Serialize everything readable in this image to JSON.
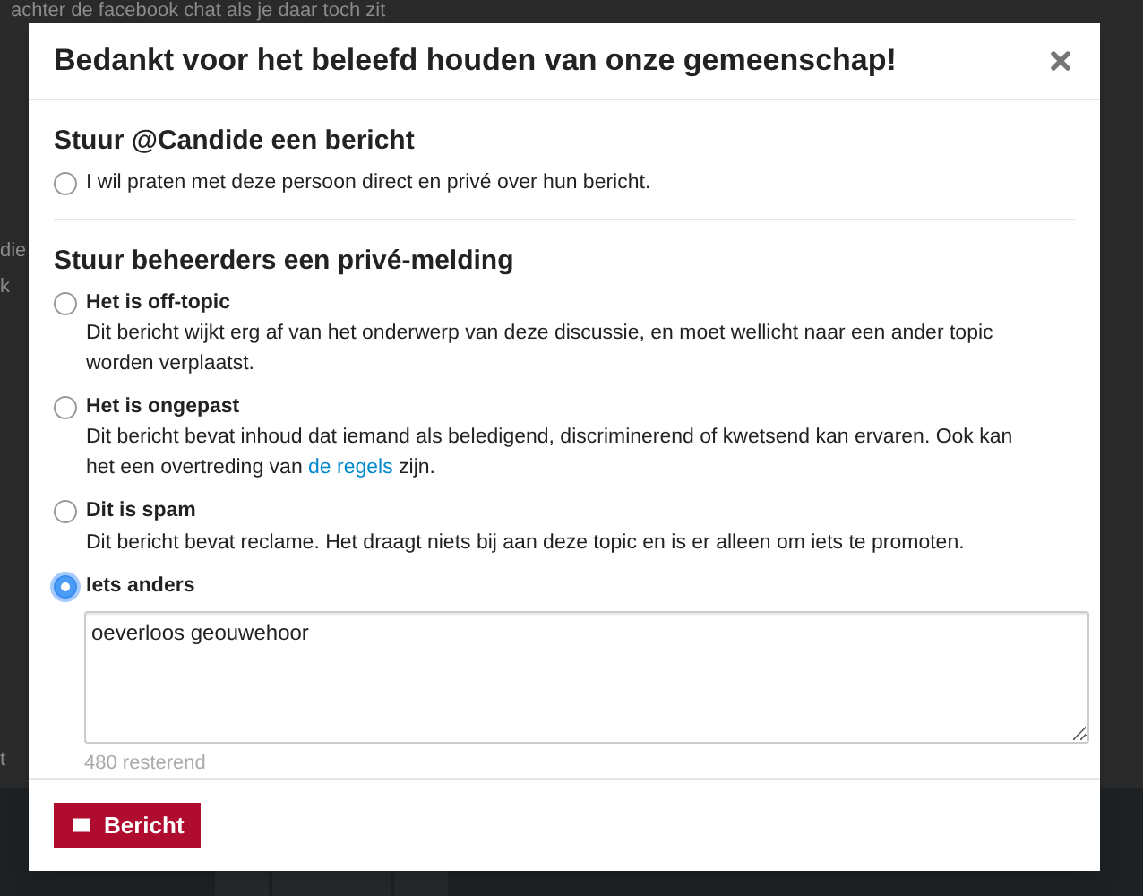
{
  "background": {
    "lines": [
      "achter de facebook chat als je daar toch zit",
      "die",
      "k",
      "t"
    ]
  },
  "modal": {
    "title": "Bedankt voor het beleefd houden van onze gemeenschap!",
    "message_section": {
      "heading": "Stuur @Candide een bericht",
      "option": {
        "label": "I wil praten met deze persoon direct en privé over hun bericht.",
        "selected": false
      }
    },
    "flag_section": {
      "heading": "Stuur beheerders een privé-melding",
      "options": [
        {
          "label": "Het is off-topic",
          "description": "Dit bericht wijkt erg af van het onderwerp van deze discussie, en moet wellicht naar een ander topic worden verplaatst.",
          "selected": false
        },
        {
          "label": "Het is ongepast",
          "description": "Dit bericht bevat inhoud dat iemand als beledigend, discriminerend of kwetsend kan ervaren. Ook kan het een overtreding van ",
          "link": "de regels",
          "description_end": " zijn.",
          "selected": false
        },
        {
          "label": "Dit is spam",
          "description": "Dit bericht bevat reclame. Het draagt niets bij aan deze topic en is er alleen om iets te promoten.",
          "selected": false
        },
        {
          "label": "Iets anders",
          "selected": true
        }
      ]
    },
    "textarea": {
      "value": "oeverloos geouwehoor",
      "counter": "480 resterend"
    },
    "submit_button": "Bericht"
  }
}
